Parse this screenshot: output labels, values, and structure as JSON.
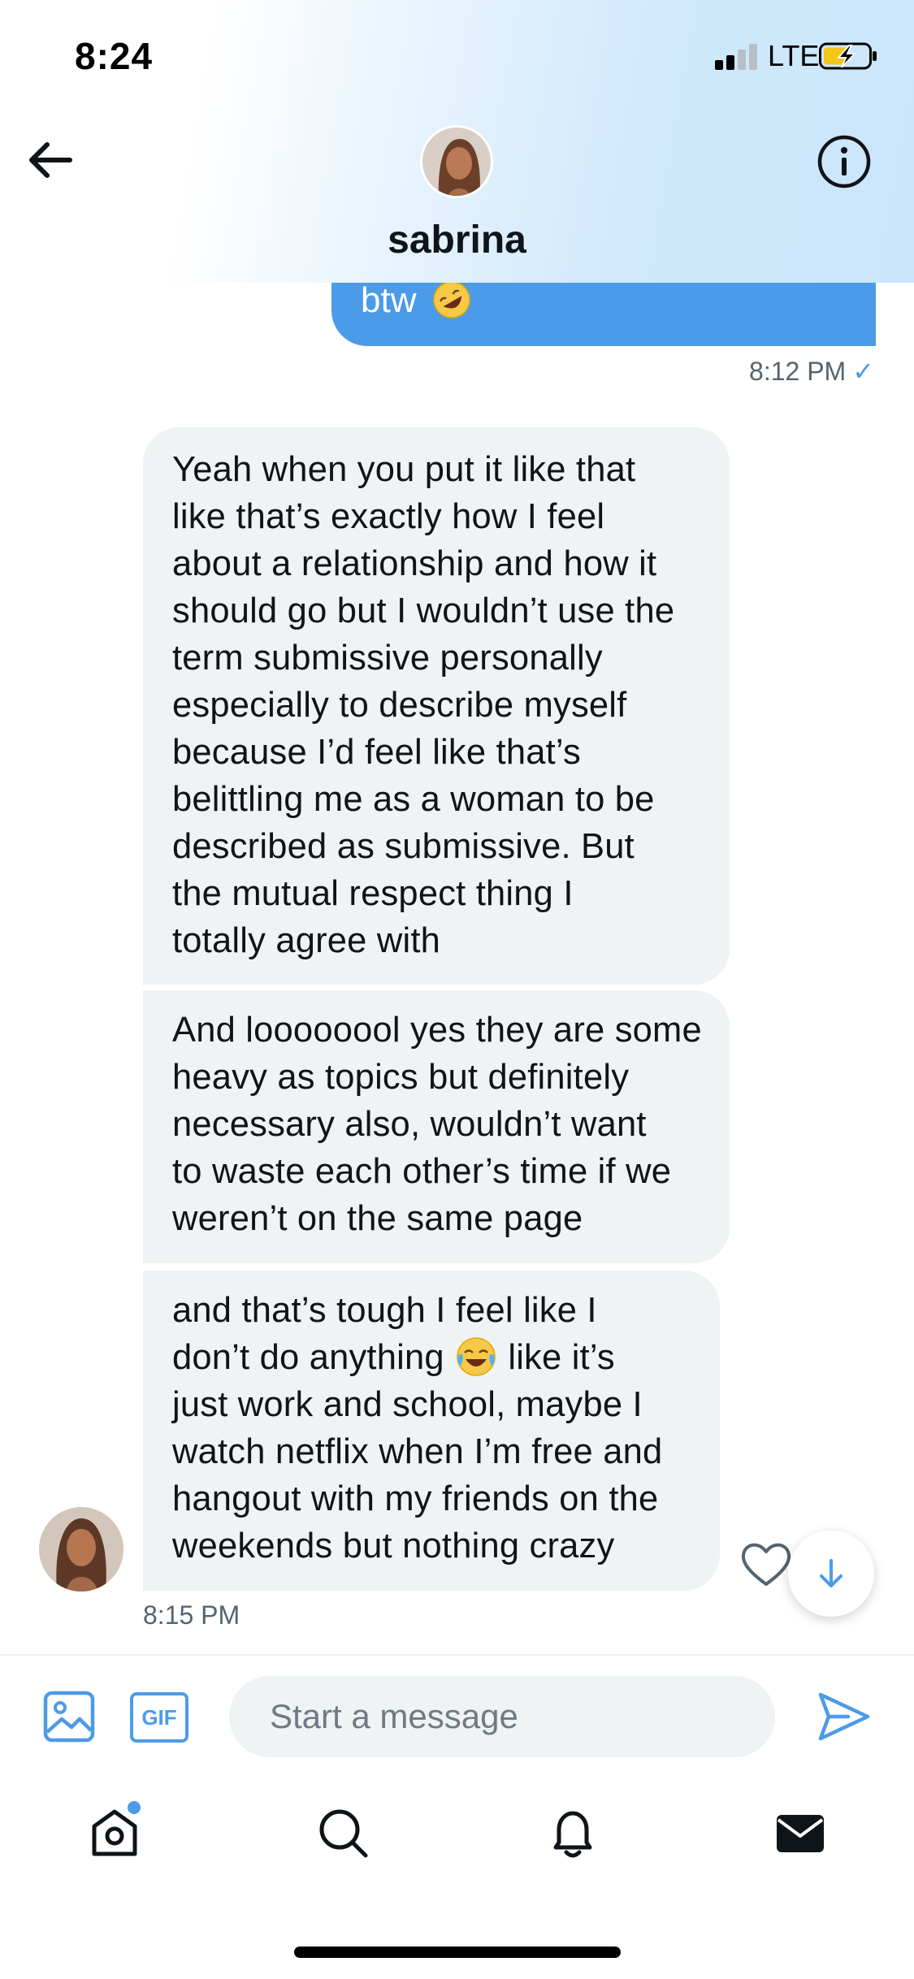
{
  "status_bar": {
    "time": "8:24",
    "network": "LTE",
    "icons": [
      "signal-icon",
      "battery-charging-icon"
    ]
  },
  "header": {
    "contact_name": "sabrina",
    "back_icon": "arrow-left-icon",
    "info_icon": "info-circle-icon"
  },
  "conversation": {
    "sent_partial": {
      "text": "btw",
      "emoji": "rolling-on-floor-laughing",
      "time": "8:12 PM",
      "status": "✓"
    },
    "received": [
      {
        "text": "Yeah when you put it like that\nlike that’s exactly how I feel\nabout a relationship and how it\nshould go but I wouldn’t use the\nterm submissive personally\nespecially to describe myself\nbecause I’d feel like that’s\nbelittling me as a woman to be\ndescribed as submissive. But\nthe mutual respect thing I\ntotally agree with"
      },
      {
        "text": "And loooooool yes they are some\nheavy as topics but definitely\nnecessary also, wouldn’t want\nto waste each other’s time if we\nweren’t on the same page"
      },
      {
        "line1": "and that’s tough I feel like I",
        "line2a": "don’t do anything ",
        "emoji": "face-with-tears-of-joy",
        "line2b": " like it’s",
        "rest": "just work and school, maybe I\nwatch netflix when I’m free and\nhangout with my friends on the\nweekends but nothing crazy"
      }
    ],
    "received_time": "8:15 PM"
  },
  "composer": {
    "placeholder": "Start a message",
    "gif_label": "GIF"
  },
  "tabs": [
    "home-icon",
    "search-icon",
    "notifications-icon",
    "messages-icon"
  ],
  "colors": {
    "accent": "#4c9be8",
    "bubble_received": "#eff3f4",
    "text": "#0f1419",
    "muted": "#536471"
  }
}
